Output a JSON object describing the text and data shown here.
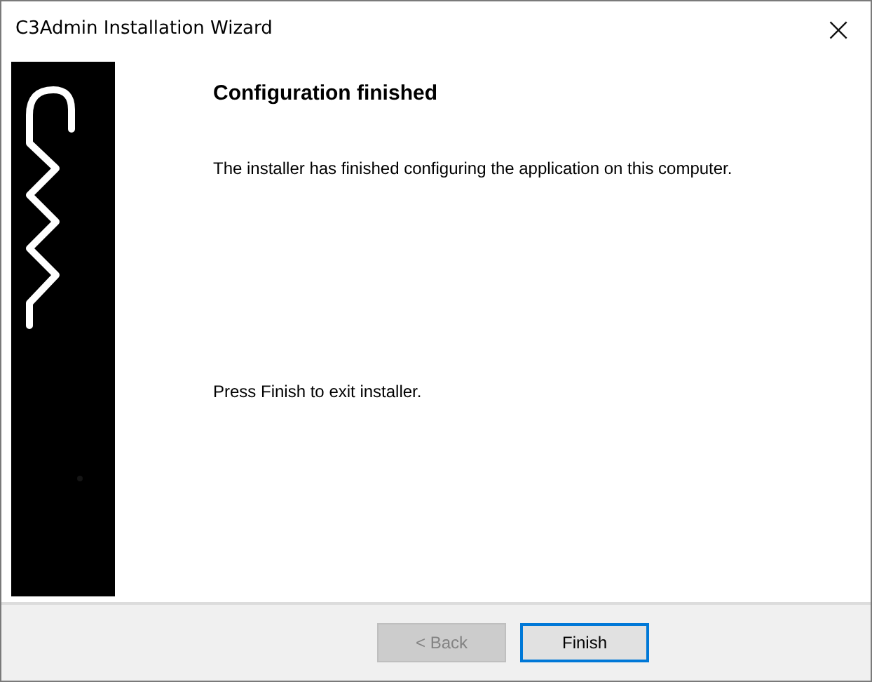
{
  "window": {
    "title": "C3Admin Installation Wizard",
    "close": "×"
  },
  "page": {
    "heading": "Configuration finished",
    "message": "The installer has finished configuring the application on this computer.",
    "instruction": "Press Finish to exit installer."
  },
  "buttons": [
    {
      "label": "< Back",
      "disabled": true,
      "focused": false
    },
    {
      "label": "Finish",
      "disabled": false,
      "focused": true
    }
  ]
}
